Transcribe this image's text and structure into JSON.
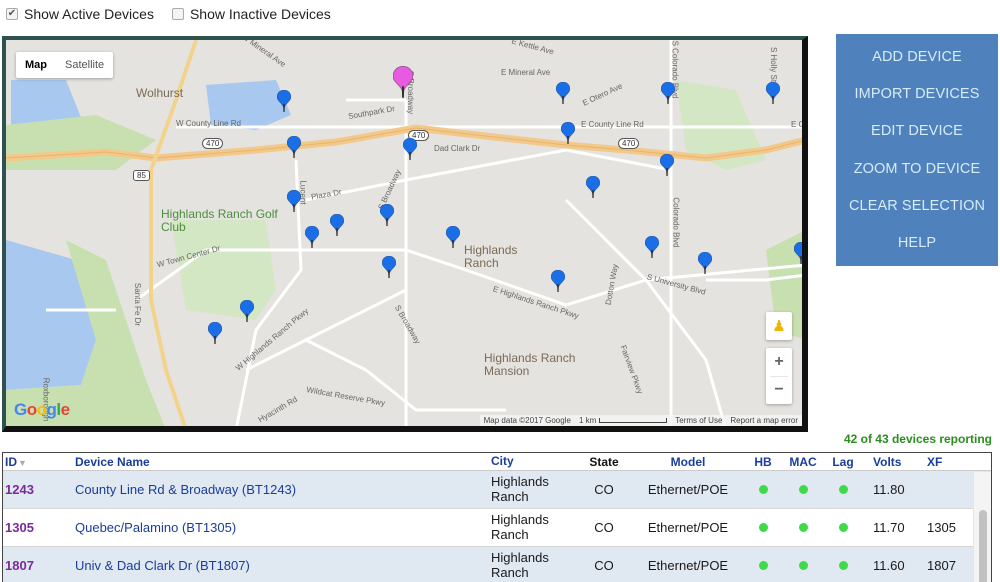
{
  "filters": {
    "show_active": {
      "label": "Show Active Devices",
      "checked": true
    },
    "show_inactive": {
      "label": "Show Inactive Devices",
      "checked": false
    }
  },
  "map": {
    "type_buttons": [
      "Map",
      "Satellite"
    ],
    "active_type": "Map",
    "road_labels": {
      "mineral_w": "W Mineral Ave",
      "kettle": "E Kettle Ave",
      "mineral_e": "E Mineral Ave",
      "otero": "E Otero Ave",
      "colorado_n": "S Colorado Blvd",
      "holly": "S Holly St",
      "county_line_w": "W County Line Rd",
      "southpark": "Southpark Dr",
      "broadway_n": "S Broadway",
      "county_line_e": "E County Line Rd",
      "county_line_e2": "E C",
      "dad_clark": "Dad Clark Dr",
      "lucent": "Lucent",
      "plaza": "Plaza Dr",
      "broadway_mid": "S Broadway",
      "colorado_s": "Colorado Blvd",
      "town_center": "W Town Center Dr",
      "santa_fe": "Santa Fe Dr",
      "highlands_ranch_e": "E Highlands Ranch Pkwy",
      "dotton": "Dotton Way",
      "university": "S University Blvd",
      "highlands_ranch_w": "W Highlands Ranch Pkwy",
      "broadway_s": "S Broadway",
      "fairview": "Fairview Pkwy",
      "wildcat": "Wildcat Reserve Pkwy",
      "hyacinth": "Hyacinth Rd",
      "roxborough": "Roxborough"
    },
    "shields": {
      "i470_a": "470",
      "i470_b": "470",
      "i470_c": "470",
      "us85": "85"
    },
    "places": {
      "wolhurst": "Wolhurst",
      "golf_club": "Highlands Ranch Golf Club",
      "highlands_ranch": "Highlands Ranch",
      "mansion": "Highlands Ranch Mansion"
    },
    "attribution": {
      "data": "Map data ©2017 Google",
      "scale": "1 km",
      "terms": "Terms of Use",
      "report": "Report a map error"
    },
    "logo": "Google",
    "zoom_in": "+",
    "zoom_out": "−",
    "colors": {
      "selected_pin": "#e85ae0",
      "pin": "#1a6fe8"
    },
    "markers": {
      "selected_count": 1,
      "device_count": 22
    }
  },
  "actions": [
    {
      "label": "ADD DEVICE"
    },
    {
      "label": "IMPORT DEVICES"
    },
    {
      "label": "EDIT DEVICE"
    },
    {
      "label": "ZOOM TO DEVICE"
    },
    {
      "label": "CLEAR SELECTION"
    },
    {
      "label": "HELP"
    }
  ],
  "status": {
    "reporting": "42 of 43 devices reporting"
  },
  "table": {
    "headers": {
      "id": "ID",
      "name": "Device Name",
      "city": "City",
      "state": "State",
      "model": "Model",
      "hb": "HB",
      "mac": "MAC",
      "lag": "Lag",
      "volts": "Volts",
      "xf": "XF"
    },
    "sort_indicator": "▼",
    "rows": [
      {
        "id": "1243",
        "name": "County Line Rd & Broadway (BT1243)",
        "city": "Highlands Ranch",
        "state": "CO",
        "model": "Ethernet/POE",
        "hb": "ok",
        "mac": "ok",
        "lag": "ok",
        "volts": "11.80",
        "xf": ""
      },
      {
        "id": "1305",
        "name": "Quebec/Palamino (BT1305)",
        "city": "Highlands Ranch",
        "state": "CO",
        "model": "Ethernet/POE",
        "hb": "ok",
        "mac": "ok",
        "lag": "ok",
        "volts": "11.70",
        "xf": "1305"
      },
      {
        "id": "1807",
        "name": "Univ & Dad Clark Dr (BT1807)",
        "city": "Highlands Ranch",
        "state": "CO",
        "model": "Ethernet/POE",
        "hb": "ok",
        "mac": "ok",
        "lag": "ok",
        "volts": "11.60",
        "xf": "1807"
      }
    ]
  }
}
